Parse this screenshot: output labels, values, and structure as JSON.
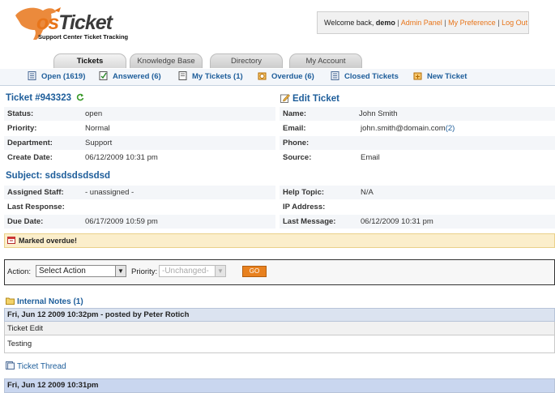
{
  "header": {
    "logo_text_os": "os",
    "logo_text_ticket": "Ticket",
    "tagline": "Support Center Ticket Tracking",
    "welcome_prefix": "Welcome back, ",
    "username": "demo",
    "links": [
      "Admin Panel",
      "My Preference",
      "Log Out"
    ],
    "separator": "|"
  },
  "tabs": [
    {
      "label": "Tickets",
      "active": true
    },
    {
      "label": "Knowledge Base",
      "active": false
    },
    {
      "label": "Directory",
      "active": false
    },
    {
      "label": "My Account",
      "active": false
    }
  ],
  "subnav": [
    {
      "label": "Open (1619)",
      "icon": "open-tickets-icon"
    },
    {
      "label": "Answered (6)",
      "icon": "answered-icon"
    },
    {
      "label": "My Tickets (1)",
      "icon": "my-tickets-icon"
    },
    {
      "label": "Overdue (6)",
      "icon": "overdue-icon"
    },
    {
      "label": "Closed Tickets",
      "icon": "closed-tickets-icon"
    },
    {
      "label": "New Ticket",
      "icon": "new-ticket-icon"
    }
  ],
  "ticket": {
    "title": "Ticket #943323",
    "edit_label": "Edit Ticket",
    "status_label": "Status:",
    "status": "open",
    "priority_label": "Priority:",
    "priority": "Normal",
    "department_label": "Department:",
    "department": "Support",
    "create_date_label": "Create Date:",
    "create_date": "06/12/2009 10:31 pm",
    "name_label": "Name:",
    "name": "John Smith",
    "email_label": "Email:",
    "email": "john.smith@domain.com",
    "email_count": "(2)",
    "phone_label": "Phone:",
    "phone": "",
    "source_label": "Source:",
    "source": "Email",
    "subject": "Subject: sdsdsdsdsdsd",
    "assigned_label": "Assigned Staff:",
    "assigned": "- unassigned -",
    "last_response_label": "Last Response:",
    "last_response": "",
    "due_date_label": "Due Date:",
    "due_date": "06/17/2009 10:59 pm",
    "help_topic_label": "Help Topic:",
    "help_topic": "N/A",
    "ip_label": "IP Address:",
    "ip": "",
    "last_message_label": "Last Message:",
    "last_message": "06/12/2009 10:31 pm"
  },
  "alert": {
    "text": "Marked overdue!"
  },
  "actions": {
    "action_label": "Action:",
    "action_value": "Select Action",
    "priority_label": "Priority:",
    "priority_value": "-Unchanged-",
    "go_label": "GO"
  },
  "notes": {
    "title": "Internal Notes (1)",
    "entry_header": "Fri, Jun 12 2009 10:32pm -  posted by Peter Rotich",
    "entry_title": "Ticket Edit",
    "entry_body": "Testing"
  },
  "thread": {
    "title": "Ticket Thread",
    "entry_header": "Fri, Jun 12 2009 10:31pm"
  },
  "colors": {
    "accent": "#e8751a",
    "link": "#1d5d9a",
    "alert_bg": "#fbeecb",
    "thread_head": "#dbe3f0"
  }
}
